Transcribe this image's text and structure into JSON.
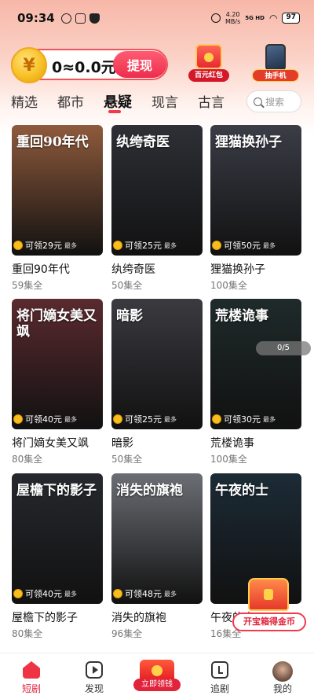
{
  "status_bar": {
    "time": "09:34",
    "net_speed_value": "4.20",
    "net_speed_unit": "MB/s",
    "signal": "5G HD",
    "battery": "97"
  },
  "wallet": {
    "balance": "0≈0.0元",
    "withdraw_label": "提现"
  },
  "promos": [
    {
      "label": "百元红包",
      "icon": "red-envelope"
    },
    {
      "label": "抽手机",
      "icon": "phone"
    }
  ],
  "category_tabs": [
    "精选",
    "都市",
    "悬疑",
    "现言",
    "古言",
    "亖"
  ],
  "active_tab": "悬疑",
  "search": {
    "placeholder": "搜索"
  },
  "dramas": [
    {
      "title": "重回90年代",
      "poster_text": "重回90年代",
      "episodes": "59集全",
      "reward": "可领29元",
      "reward_suffix": "最多",
      "bg": "#8f5a3c"
    },
    {
      "title": "纨绔奇医",
      "poster_text": "纨绔奇医",
      "episodes": "50集全",
      "reward": "可领25元",
      "reward_suffix": "最多",
      "bg": "#2e3036"
    },
    {
      "title": "狸猫换孙子",
      "poster_text": "狸猫换孙子",
      "episodes": "100集全",
      "reward": "可领50元",
      "reward_suffix": "最多",
      "bg": "#3b3d47"
    },
    {
      "title": "将门嫡女美又飒",
      "poster_text": "将门嫡女美又飒",
      "episodes": "80集全",
      "reward": "可领40元",
      "reward_suffix": "最多",
      "bg": "#5a2a2e"
    },
    {
      "title": "暗影",
      "poster_text": "暗影",
      "episodes": "50集全",
      "reward": "可领25元",
      "reward_suffix": "最多",
      "bg": "#3a3a40"
    },
    {
      "title": "荒楼诡事",
      "poster_text": "荒楼诡事",
      "episodes": "100集全",
      "reward": "可领30元",
      "reward_suffix": "最多",
      "bg": "#1f2a2a"
    },
    {
      "title": "屋檐下的影子",
      "poster_text": "屋檐下的影子",
      "episodes": "80集全",
      "reward": "可领40元",
      "reward_suffix": "最多",
      "bg": "#26282d"
    },
    {
      "title": "消失的旗袍",
      "poster_text": "消失的旗袍",
      "episodes": "96集全",
      "reward": "可领48元",
      "reward_suffix": "最多",
      "bg": "#6b6e74"
    },
    {
      "title": "午夜的士",
      "poster_text": "午夜的士",
      "episodes": "16集全",
      "reward": "",
      "reward_suffix": "",
      "bg": "#1c2b36"
    }
  ],
  "carousel_indicator": "0/5",
  "treasure": {
    "label": "开宝箱得金币"
  },
  "bottom_nav": [
    {
      "label": "短剧",
      "icon": "home-icon",
      "active": true
    },
    {
      "label": "发现",
      "icon": "play-icon",
      "active": false
    },
    {
      "label": "立即领钱",
      "icon": "red-envelope-icon",
      "active": false
    },
    {
      "label": "追剧",
      "icon": "follow-icon",
      "active": false
    },
    {
      "label": "我的",
      "icon": "avatar-icon",
      "active": false
    }
  ],
  "colors": {
    "accent": "#e2233c",
    "header_bg": "#f7b7a8"
  }
}
